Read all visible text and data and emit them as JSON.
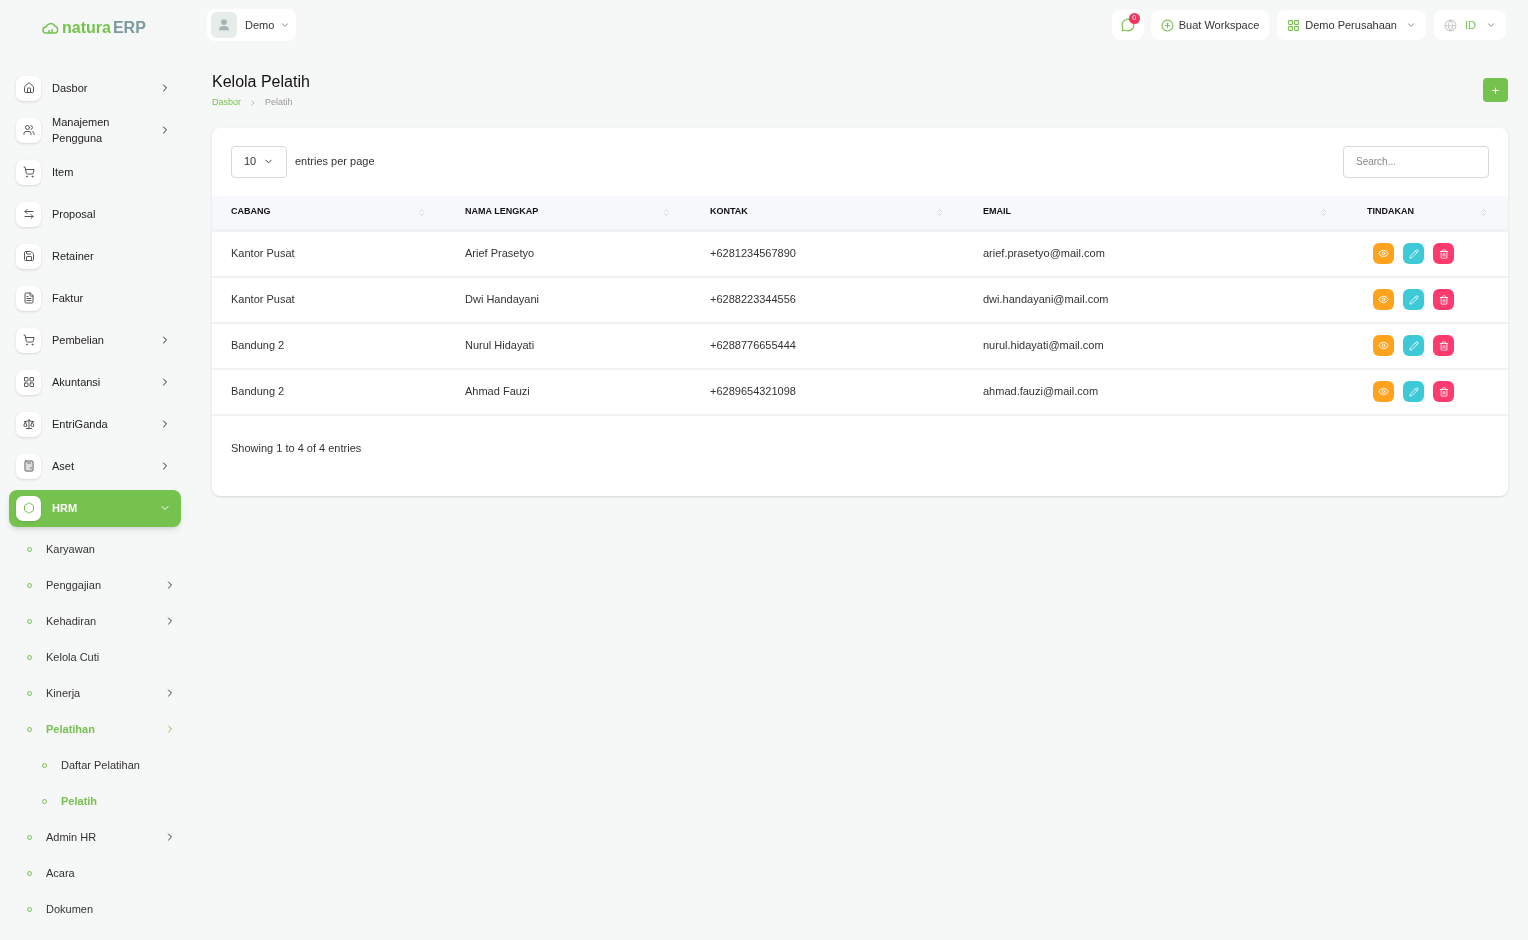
{
  "logo": {
    "text_a": "natura",
    "text_b": "ERP"
  },
  "header": {
    "user": "Demo",
    "notification_count": "0",
    "create_workspace": "Buat Workspace",
    "company": "Demo Perusahaan",
    "language": "ID"
  },
  "sidebar": {
    "items": [
      {
        "label": "Dasbor",
        "has_arrow": true,
        "expanded": false,
        "selected": false
      },
      {
        "label": "Manajemen Pengguna",
        "has_arrow": true,
        "expanded": false,
        "selected": false
      },
      {
        "label": "Item",
        "has_arrow": false,
        "selected": false
      },
      {
        "label": "Proposal",
        "has_arrow": false,
        "selected": false
      },
      {
        "label": "Retainer",
        "has_arrow": false,
        "selected": false
      },
      {
        "label": "Faktur",
        "has_arrow": false,
        "selected": false
      },
      {
        "label": "Pembelian",
        "has_arrow": true,
        "expanded": false,
        "selected": false
      },
      {
        "label": "Akuntansi",
        "has_arrow": true,
        "expanded": false,
        "selected": false
      },
      {
        "label": "EntriGanda",
        "has_arrow": true,
        "expanded": false,
        "selected": false
      },
      {
        "label": "Aset",
        "has_arrow": true,
        "expanded": false,
        "selected": false
      },
      {
        "label": "HRM",
        "has_arrow": true,
        "expanded": true,
        "selected": true,
        "children": [
          {
            "label": "Karyawan",
            "has_arrow": false,
            "selected": false
          },
          {
            "label": "Penggajian",
            "has_arrow": true,
            "selected": false
          },
          {
            "label": "Kehadiran",
            "has_arrow": true,
            "selected": false
          },
          {
            "label": "Kelola Cuti",
            "has_arrow": false,
            "selected": false
          },
          {
            "label": "Kinerja",
            "has_arrow": true,
            "selected": false
          },
          {
            "label": "Pelatihan",
            "has_arrow": true,
            "selected": true,
            "children": [
              {
                "label": "Daftar Pelatihan",
                "selected": false
              },
              {
                "label": "Pelatih",
                "selected": true
              }
            ]
          },
          {
            "label": "Admin HR",
            "has_arrow": true,
            "selected": false
          },
          {
            "label": "Acara",
            "has_arrow": false,
            "selected": false
          },
          {
            "label": "Dokumen",
            "has_arrow": false,
            "selected": false
          }
        ]
      }
    ]
  },
  "page": {
    "title": "Kelola Pelatih",
    "breadcrumb": [
      "Dasbor",
      "Pelatih"
    ],
    "add_button": "+"
  },
  "table": {
    "page_size": "10",
    "page_size_label": "entries per page",
    "search_placeholder": "Search...",
    "columns": [
      "CABANG",
      "NAMA LENGKAP",
      "KONTAK",
      "EMAIL",
      "TINDAKAN"
    ],
    "rows": [
      [
        "Kantor Pusat",
        "Arief Prasetyo",
        "+6281234567890",
        "arief.prasetyo@mail.com"
      ],
      [
        "Kantor Pusat",
        "Dwi Handayani",
        "+6288223344556",
        "dwi.handayani@mail.com"
      ],
      [
        "Bandung 2",
        "Nurul Hidayati",
        "+6288776655444",
        "nurul.hidayati@mail.com"
      ],
      [
        "Bandung 2",
        "Ahmad Fauzi",
        "+6289654321098",
        "ahmad.fauzi@mail.com"
      ]
    ],
    "footer": "Showing 1 to 4 of 4 entries"
  }
}
